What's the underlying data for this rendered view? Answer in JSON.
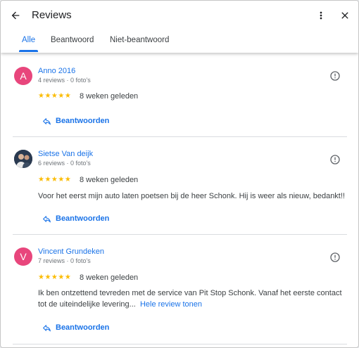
{
  "header": {
    "title": "Reviews",
    "icons": {
      "back": "arrow-back-icon",
      "more": "more-vert-icon",
      "close": "close-icon"
    }
  },
  "tabs": [
    {
      "label": "Alle",
      "active": true
    },
    {
      "label": "Beantwoord",
      "active": false
    },
    {
      "label": "Niet-beantwoord",
      "active": false
    }
  ],
  "reviews": [
    {
      "avatar_letter": "A",
      "avatar_color": "#e8467c",
      "name": "Anno 2016",
      "meta": "4 reviews · 0 foto's",
      "stars": "★★★★★",
      "rating": 5,
      "date": "8 weken geleden",
      "text": "",
      "reply_label": "Beantwoorden"
    },
    {
      "avatar_letter": "",
      "avatar_color": "#1f2d40",
      "avatar_type": "photo",
      "name": "Sietse Van deijk",
      "meta": "6 reviews · 0 foto's",
      "stars": "★★★★★",
      "rating": 5,
      "date": "8 weken geleden",
      "text": "Voor het eerst mijn auto laten poetsen bij de heer Schonk. Hij is weer als nieuw, bedankt!!",
      "reply_label": "Beantwoorden"
    },
    {
      "avatar_letter": "V",
      "avatar_color": "#e8467c",
      "name": "Vincent Grundeken",
      "meta": "7 reviews · 0 foto's",
      "stars": "★★★★★",
      "rating": 5,
      "date": "8 weken geleden",
      "text": "Ik ben ontzettend tevreden met de service van Pit Stop Schonk. Vanaf het eerste contact tot de uiteindelijke levering...",
      "more_link": "Hele review tonen",
      "reply_label": "Beantwoorden"
    }
  ],
  "colors": {
    "accent": "#1a73e8",
    "star": "#fbbc04",
    "avatar_pink": "#e8467c"
  }
}
